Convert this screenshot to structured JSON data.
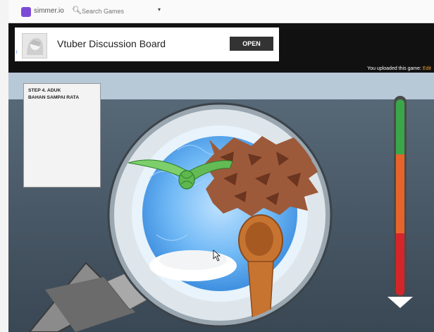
{
  "topbar": {
    "logo_text": "simmer.io",
    "search_placeholder": "Search Games",
    "caret": "▾"
  },
  "ad": {
    "title": "Vtuber Discussion Board",
    "open_label": "OPEN",
    "small_label": "i"
  },
  "upload_notice": {
    "text": "You uploaded this game:",
    "edit_label": "Edit"
  },
  "game": {
    "step_text": "STEP 4.    ADUK\nBAHAN SAMPAI RATA"
  },
  "colors": {
    "meter_green": "#3aa64a",
    "meter_orange": "#e6642c",
    "meter_red": "#d6252a",
    "brand": "#7b4bd8"
  },
  "icons": {
    "search": "search-icon",
    "logo": "simmer-logo-icon",
    "arrow": "arrow-down-icon"
  }
}
